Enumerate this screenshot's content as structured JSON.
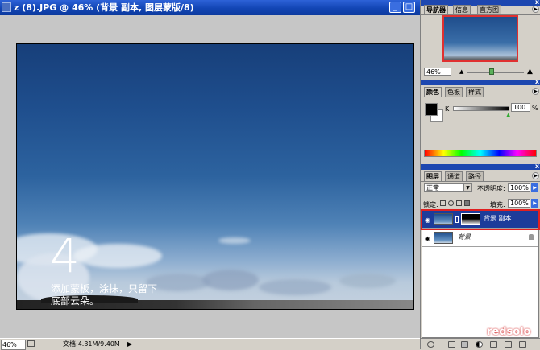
{
  "document": {
    "title": "z (8).JPG @ 46% (背景 副本, 图层蒙版/8)",
    "overlay_number": "4",
    "overlay_caption": "添加蒙板，涂抹，只留下底部云朵。",
    "status": {
      "zoom": "46%",
      "info": "文档:4.31M/9.40M",
      "arrow": "▶"
    },
    "buttons": {
      "minimize": "_",
      "maximize": "□",
      "close": "×"
    }
  },
  "navigator": {
    "tabs": [
      "导航器",
      "信息",
      "直方图"
    ],
    "zoom": "46%"
  },
  "color": {
    "tabs": [
      "颜色",
      "色板",
      "样式"
    ],
    "channel_label": "K",
    "value": "100",
    "unit": "%"
  },
  "layers": {
    "tabs": [
      "图层",
      "通道",
      "路径"
    ],
    "blend_mode": "正常",
    "opacity_label": "不透明度:",
    "opacity": "100%",
    "lock_label": "锁定:",
    "fill_label": "填充:",
    "fill": "100%",
    "items": [
      {
        "name": "背景 副本",
        "selected": true
      },
      {
        "name": "背景",
        "selected": false
      }
    ]
  },
  "watermark": {
    "line1": "by",
    "line2": "redsolo"
  },
  "colors": {
    "titlebar": "#1245b4",
    "selection": "#1d3c9a",
    "highlight": "#e02020"
  }
}
